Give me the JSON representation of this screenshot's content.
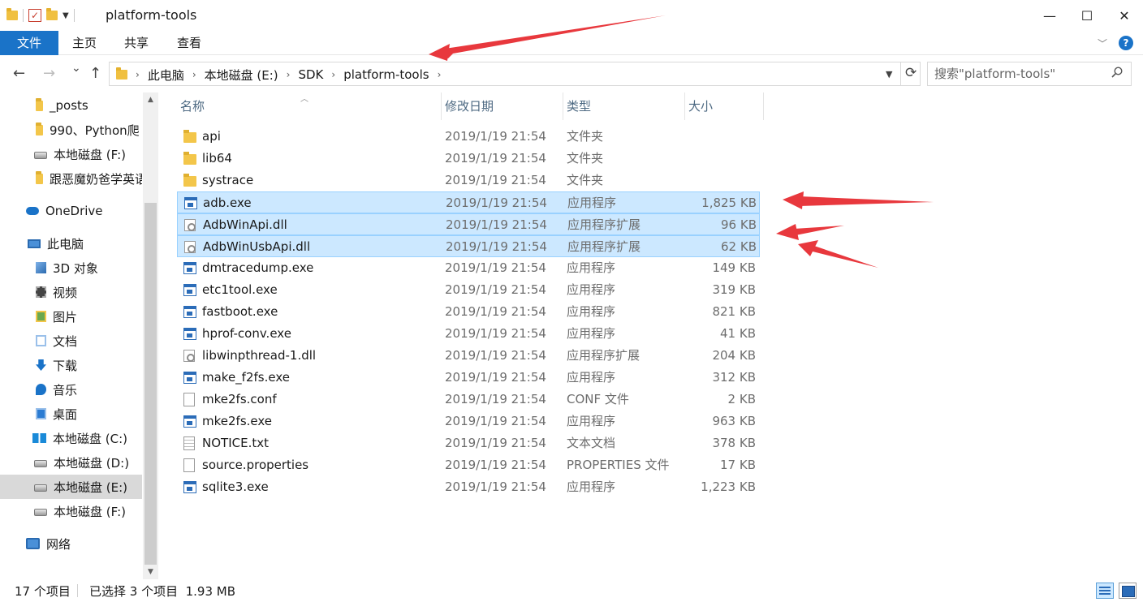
{
  "window": {
    "title": "platform-tools",
    "minimize": "—",
    "maximize": "☐",
    "close": "✕"
  },
  "ribbon": {
    "tabs": [
      "文件",
      "主页",
      "共享",
      "查看"
    ],
    "help": "?"
  },
  "nav": {
    "back": "←",
    "forward": "→",
    "recent": "⌄",
    "up": "↑"
  },
  "address": {
    "crumbs": [
      "此电脑",
      "本地磁盘 (E:)",
      "SDK",
      "platform-tools"
    ]
  },
  "search": {
    "placeholder": "搜索\"platform-tools\""
  },
  "sidebar": {
    "items": [
      {
        "label": "_posts",
        "icon": "folder-icon"
      },
      {
        "label": "990、Python爬",
        "icon": "folder-icon"
      },
      {
        "label": "本地磁盘 (F:)",
        "icon": "drive-icon"
      },
      {
        "label": "跟恶魔奶爸学英语",
        "icon": "folder-icon"
      },
      {
        "label": "OneDrive",
        "icon": "onedrive-cloud-icon"
      },
      {
        "label": "此电脑",
        "icon": "this-pc-icon"
      },
      {
        "label": "3D 对象",
        "icon": "3d-objects-icon"
      },
      {
        "label": "视频",
        "icon": "videos-icon"
      },
      {
        "label": "图片",
        "icon": "pictures-icon"
      },
      {
        "label": "文档",
        "icon": "documents-icon"
      },
      {
        "label": "下载",
        "icon": "downloads-icon"
      },
      {
        "label": "音乐",
        "icon": "music-icon"
      },
      {
        "label": "桌面",
        "icon": "desktop-icon"
      },
      {
        "label": "本地磁盘 (C:)",
        "icon": "windows-drive-icon"
      },
      {
        "label": "本地磁盘 (D:)",
        "icon": "drive-icon"
      },
      {
        "label": "本地磁盘 (E:)",
        "icon": "drive-icon"
      },
      {
        "label": "本地磁盘 (F:)",
        "icon": "drive-icon"
      },
      {
        "label": "网络",
        "icon": "network-icon"
      }
    ]
  },
  "columns": {
    "name": "名称",
    "date": "修改日期",
    "type": "类型",
    "size": "大小"
  },
  "files": [
    {
      "name": "api",
      "date": "2019/1/19 21:54",
      "type": "文件夹",
      "size": "",
      "icon": "folder-icon",
      "selected": false
    },
    {
      "name": "lib64",
      "date": "2019/1/19 21:54",
      "type": "文件夹",
      "size": "",
      "icon": "folder-icon",
      "selected": false
    },
    {
      "name": "systrace",
      "date": "2019/1/19 21:54",
      "type": "文件夹",
      "size": "",
      "icon": "folder-icon",
      "selected": false
    },
    {
      "name": "adb.exe",
      "date": "2019/1/19 21:54",
      "type": "应用程序",
      "size": "1,825 KB",
      "icon": "exe-icon",
      "selected": true
    },
    {
      "name": "AdbWinApi.dll",
      "date": "2019/1/19 21:54",
      "type": "应用程序扩展",
      "size": "96 KB",
      "icon": "dll-icon",
      "selected": true
    },
    {
      "name": "AdbWinUsbApi.dll",
      "date": "2019/1/19 21:54",
      "type": "应用程序扩展",
      "size": "62 KB",
      "icon": "dll-icon",
      "selected": true
    },
    {
      "name": "dmtracedump.exe",
      "date": "2019/1/19 21:54",
      "type": "应用程序",
      "size": "149 KB",
      "icon": "exe-icon",
      "selected": false
    },
    {
      "name": "etc1tool.exe",
      "date": "2019/1/19 21:54",
      "type": "应用程序",
      "size": "319 KB",
      "icon": "exe-icon",
      "selected": false
    },
    {
      "name": "fastboot.exe",
      "date": "2019/1/19 21:54",
      "type": "应用程序",
      "size": "821 KB",
      "icon": "exe-icon",
      "selected": false
    },
    {
      "name": "hprof-conv.exe",
      "date": "2019/1/19 21:54",
      "type": "应用程序",
      "size": "41 KB",
      "icon": "exe-icon",
      "selected": false
    },
    {
      "name": "libwinpthread-1.dll",
      "date": "2019/1/19 21:54",
      "type": "应用程序扩展",
      "size": "204 KB",
      "icon": "dll-icon",
      "selected": false
    },
    {
      "name": "make_f2fs.exe",
      "date": "2019/1/19 21:54",
      "type": "应用程序",
      "size": "312 KB",
      "icon": "exe-icon",
      "selected": false
    },
    {
      "name": "mke2fs.conf",
      "date": "2019/1/19 21:54",
      "type": "CONF 文件",
      "size": "2 KB",
      "icon": "file-icon",
      "selected": false
    },
    {
      "name": "mke2fs.exe",
      "date": "2019/1/19 21:54",
      "type": "应用程序",
      "size": "963 KB",
      "icon": "exe-icon",
      "selected": false
    },
    {
      "name": "NOTICE.txt",
      "date": "2019/1/19 21:54",
      "type": "文本文档",
      "size": "378 KB",
      "icon": "txt-icon",
      "selected": false
    },
    {
      "name": "source.properties",
      "date": "2019/1/19 21:54",
      "type": "PROPERTIES 文件",
      "size": "17 KB",
      "icon": "file-icon",
      "selected": false
    },
    {
      "name": "sqlite3.exe",
      "date": "2019/1/19 21:54",
      "type": "应用程序",
      "size": "1,223 KB",
      "icon": "exe-icon",
      "selected": false
    }
  ],
  "status": {
    "item_count": "17 个项目",
    "selection": "已选择 3 个项目  1.93 MB"
  },
  "colors": {
    "accent": "#1a73c8",
    "selection_bg": "#cce8ff",
    "selection_border": "#99d1ff",
    "annotation_arrow": "#e8383d"
  }
}
